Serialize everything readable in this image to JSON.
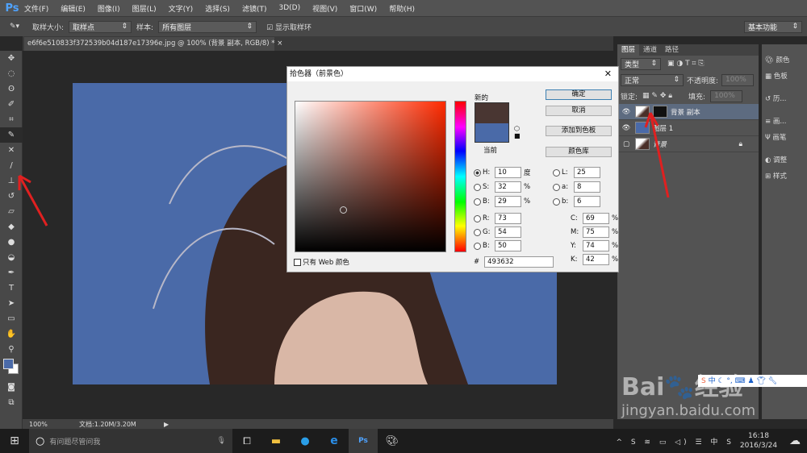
{
  "app": {
    "logo": "Ps",
    "menu": [
      "文件(F)",
      "编辑(E)",
      "图像(I)",
      "图层(L)",
      "文字(Y)",
      "选择(S)",
      "滤镜(T)",
      "3D(D)",
      "视图(V)",
      "窗口(W)",
      "帮助(H)"
    ],
    "workspace": "基本功能"
  },
  "options": {
    "sample_size_label": "取样大小:",
    "sample_size": "取样点",
    "sample_label": "样本:",
    "sample": "所有图层",
    "show_ring": "显示取样环"
  },
  "document": {
    "tab": "e6f6e510833f372539b04d187e17396e.jpg @ 100% (背景 副本, RGB/8) *",
    "zoom": "100%",
    "doc_info": "文档:1.20M/3.20M"
  },
  "dialog": {
    "title": "拾色器（前景色）",
    "new_label": "新的",
    "current_label": "当前",
    "new_color": "#493632",
    "current_color": "#4a6aa8",
    "buttons": {
      "ok": "确定",
      "cancel": "取消",
      "add_swatch": "添加到色板",
      "libraries": "颜色库"
    },
    "web_only": "只有 Web 颜色",
    "hsb": [
      {
        "l": "H:",
        "v": "10",
        "u": "度"
      },
      {
        "l": "S:",
        "v": "32",
        "u": "%"
      },
      {
        "l": "B:",
        "v": "29",
        "u": "%"
      }
    ],
    "rgb": [
      {
        "l": "R:",
        "v": "73"
      },
      {
        "l": "G:",
        "v": "54"
      },
      {
        "l": "B:",
        "v": "50"
      }
    ],
    "lab": [
      {
        "l": "L:",
        "v": "25"
      },
      {
        "l": "a:",
        "v": "8"
      },
      {
        "l": "b:",
        "v": "6"
      }
    ],
    "cmyk": [
      {
        "l": "C:",
        "v": "69",
        "u": "%"
      },
      {
        "l": "M:",
        "v": "75",
        "u": "%"
      },
      {
        "l": "Y:",
        "v": "74",
        "u": "%"
      },
      {
        "l": "K:",
        "v": "42",
        "u": "%"
      }
    ],
    "hex_label": "#",
    "hex": "493632"
  },
  "layers_panel": {
    "tabs": [
      "图层",
      "通道",
      "路径"
    ],
    "filter": "类型",
    "blend": "正常",
    "opacity_label": "不透明度:",
    "opacity": "100%",
    "lock_label": "锁定:",
    "fill_label": "填充:",
    "fill": "100%",
    "layers": [
      {
        "name": "背景 副本"
      },
      {
        "name": "图层 1"
      },
      {
        "name": "背景"
      }
    ]
  },
  "dock": [
    "颜色",
    "色板",
    "历...",
    "画...",
    "画笔",
    "调整",
    "样式"
  ],
  "taskbar": {
    "search": "有问题尽管问我",
    "time": "16:18",
    "date": "2016/3/24",
    "ime": "中"
  },
  "watermark": {
    "brand": "Bai du 经验",
    "url": "jingyan.baidu.com"
  }
}
